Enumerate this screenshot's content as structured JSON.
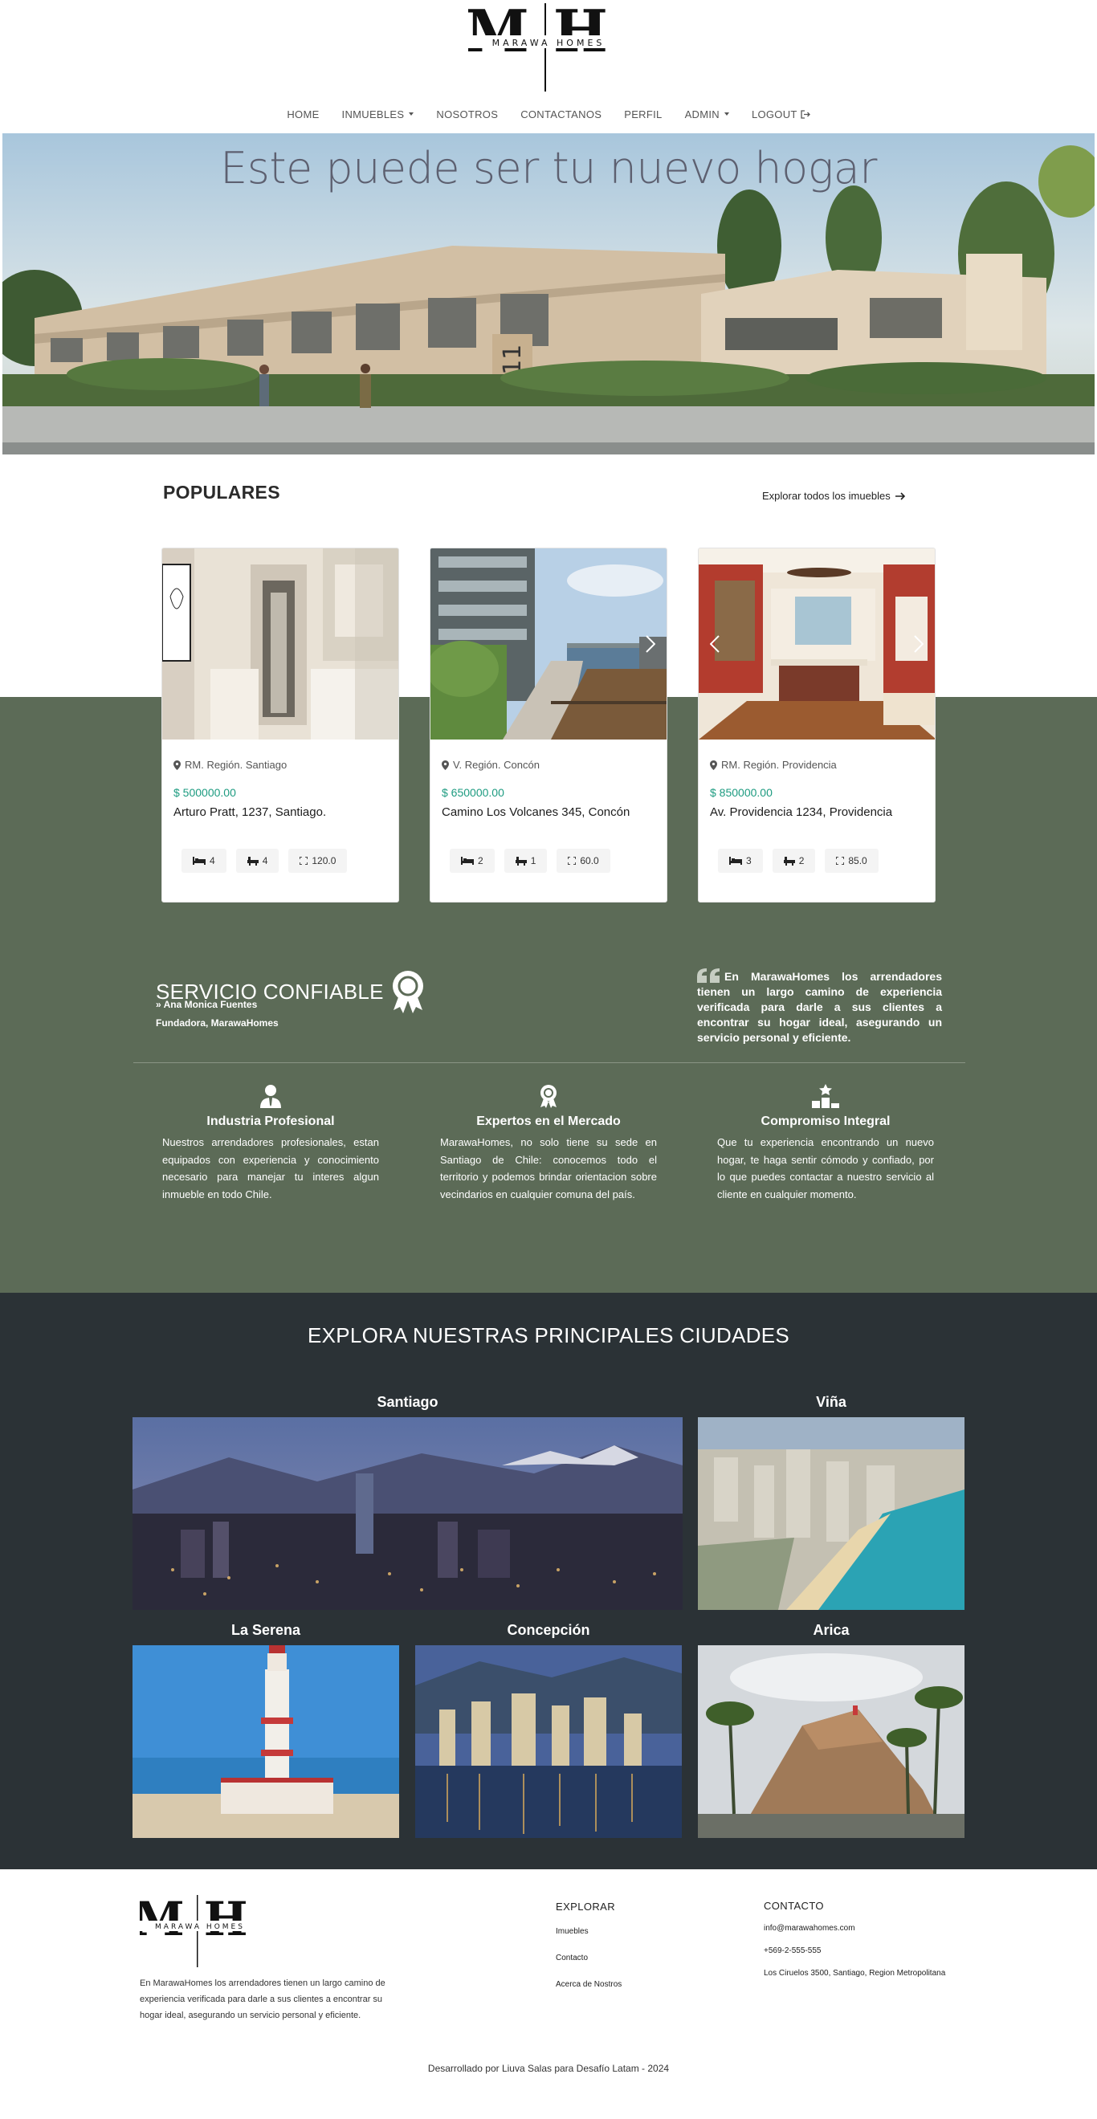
{
  "brand": {
    "logo_letters": "MH",
    "logo_name": "MARAWA HOMES"
  },
  "nav": {
    "home": "HOME",
    "inmuebles": "INMUEBLES",
    "nosotros": "NOSOTROS",
    "contactanos": "CONTACTANOS",
    "perfil": "PERFIL",
    "admin": "ADMIN",
    "logout": "LOGOUT"
  },
  "hero": {
    "title": "Este puede ser tu nuevo hogar"
  },
  "populares": {
    "title": "POPULARES",
    "explore_link": "Explorar todos los imuebles",
    "cards": [
      {
        "location": "RM. Región. Santiago",
        "price": "$ 500000.00",
        "address": "Arturo Pratt, 1237, Santiago.",
        "beds": "4",
        "baths": "4",
        "area": "120.0"
      },
      {
        "location": "V. Región. Concón",
        "price": "$ 650000.00",
        "address": "Camino Los Volcanes 345, Concón",
        "beds": "2",
        "baths": "1",
        "area": "60.0"
      },
      {
        "location": "RM. Región. Providencia",
        "price": "$ 850000.00",
        "address": "Av. Providencia 1234, Providencia",
        "beds": "3",
        "baths": "2",
        "area": "85.0"
      }
    ]
  },
  "servicio": {
    "title": "SERVICIO CONFIABLE",
    "name": "Ana Monica Fuentes",
    "role": "Fundadora, MarawaHomes",
    "quote": "En MarawaHomes los arrendadores tienen un largo camino de experiencia verificada para darle a sus clientes a encontrar su hogar ideal, asegurando un servicio personal y eficiente.",
    "features": [
      {
        "title": "Industria Profesional",
        "text": "Nuestros arrendadores profesionales, estan equipados con experiencia y conocimiento necesario para manejar tu interes algun inmueble en todo Chile."
      },
      {
        "title": "Expertos en el Mercado",
        "text": "MarawaHomes, no solo tiene su sede en Santiago de Chile: conocemos todo el territorio y podemos brindar orientacion sobre vecindarios en cualquier comuna del país."
      },
      {
        "title": "Compromiso Integral",
        "text": "Que tu experiencia encontrando un nuevo hogar, te haga sentir cómodo y confiado, por lo que puedes contactar a nuestro servicio al cliente en cualquier momento."
      }
    ]
  },
  "cities": {
    "title": "EXPLORA NUESTRAS PRINCIPALES CIUDADES",
    "santiago": "Santiago",
    "vina": "Viña",
    "la_serena": "La Serena",
    "concepcion": "Concepción",
    "arica": "Arica"
  },
  "footer": {
    "about": "En MarawaHomes los arrendadores tienen un largo camino de experiencia verificada para darle a sus clientes a encontrar su hogar ideal, asegurando un servicio personal y eficiente.",
    "explorar_title": "EXPLORAR",
    "explorar_items": [
      "Imuebles",
      "Contacto",
      "Acerca de Nostros"
    ],
    "contacto_title": "CONTACTO",
    "contacto_items": [
      "info@marawahomes.com",
      "+569-2-555-555",
      "Los Ciruelos 3500, Santiago, Region Metropolitana"
    ],
    "credits": "Desarrollado por Liuva Salas para Desafío Latam - 2024"
  },
  "colors": {
    "green_band": "#5c6b57",
    "dark_band": "#2b3236",
    "price": "#1d9b80"
  }
}
